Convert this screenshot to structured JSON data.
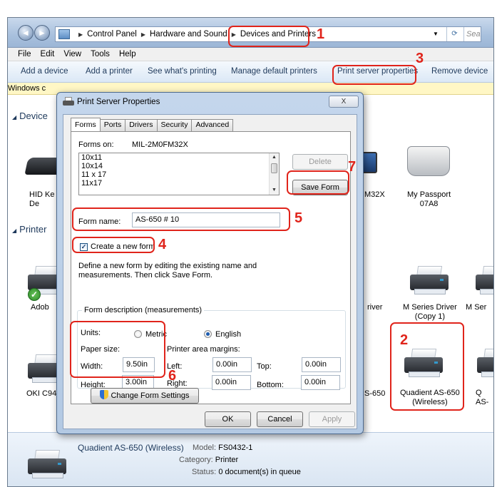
{
  "explorer": {
    "breadcrumb": [
      "Control Panel",
      "Hardware and Sound",
      "Devices and Printers"
    ],
    "search_placeholder": "Sea",
    "menu": [
      "File",
      "Edit",
      "View",
      "Tools",
      "Help"
    ],
    "commands": [
      "Add a device",
      "Add a printer",
      "See what's printing",
      "Manage default printers",
      "Print server properties",
      "Remove device"
    ],
    "infobar": "Windows c",
    "sections": {
      "devices": "Device",
      "printers": "Printer"
    },
    "devices": [
      {
        "label": "HID Ke\nDe"
      },
      {
        "label": "M32X"
      },
      {
        "label": "My Passport\n07A8"
      }
    ],
    "printers": [
      {
        "label": "Adob"
      },
      {
        "label": "river"
      },
      {
        "label": "M Series Driver\n(Copy 1)"
      },
      {
        "label": "M Ser"
      },
      {
        "label": "OKI C94"
      },
      {
        "label": "S-650"
      },
      {
        "label": "Quadient AS-650\n(Wireless)"
      },
      {
        "label": "Q\nAS-"
      }
    ],
    "details": {
      "name": "Quadient AS-650 (Wireless)",
      "model_label": "Model:",
      "model_value": "FS0432-1",
      "category_label": "Category:",
      "category_value": "Printer",
      "status_label": "Status:",
      "status_value": "0 document(s) in queue"
    }
  },
  "dialog": {
    "title": "Print Server Properties",
    "close_label": "X",
    "tabs": [
      "Forms",
      "Ports",
      "Drivers",
      "Security",
      "Advanced"
    ],
    "active_tab": "Forms",
    "forms_on_label": "Forms on:",
    "server_name": "MIL-2M0FM32X",
    "form_list": [
      "10x11",
      "10x14",
      "11 x 17",
      "11x17"
    ],
    "delete_label": "Delete",
    "save_form_label": "Save Form",
    "form_name_label": "Form name:",
    "form_name_value": "AS-650 # 10",
    "create_new_form_label": "Create a new form",
    "create_new_form_checked": true,
    "instructions": "Define a new form by editing the existing name and measurements. Then click Save Form.",
    "group_title": "Form description (measurements)",
    "units_label": "Units:",
    "unit_metric": "Metric",
    "unit_english": "English",
    "selected_unit": "English",
    "paper_size_label": "Paper size:",
    "width_label": "Width:",
    "width_value": "9.50in",
    "height_label": "Height:",
    "height_value": "3.00in",
    "margins_label": "Printer area margins:",
    "left_label": "Left:",
    "left_value": "0.00in",
    "right_label": "Right:",
    "right_value": "0.00in",
    "top_label": "Top:",
    "top_value": "0.00in",
    "bottom_label": "Bottom:",
    "bottom_value": "0.00in",
    "change_settings_label": "Change Form Settings",
    "ok_label": "OK",
    "cancel_label": "Cancel",
    "apply_label": "Apply"
  },
  "annotations": [
    "1",
    "2",
    "3",
    "4",
    "5",
    "6",
    "7"
  ],
  "colors": {
    "annotation": "#e0241b",
    "explorer_link": "#1e395b",
    "infobar": "#fff7c5"
  }
}
